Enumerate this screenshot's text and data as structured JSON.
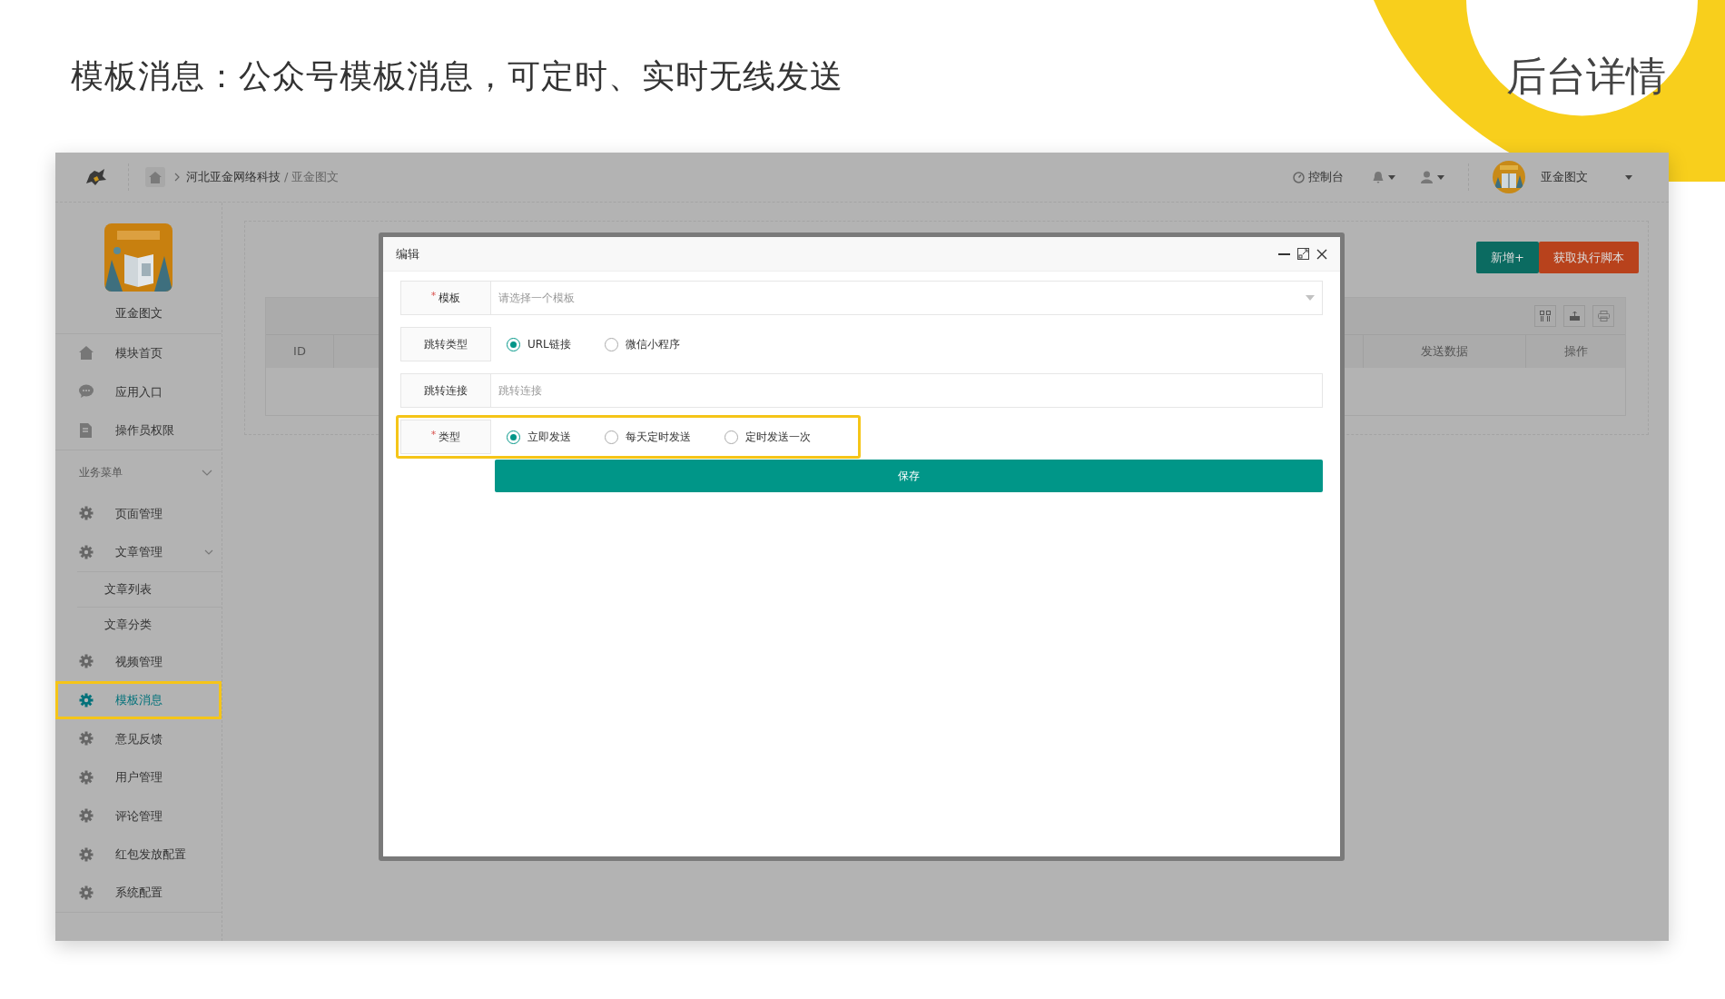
{
  "slide": {
    "title": "模板消息：公众号模板消息，可定时、实时无线发送",
    "tag": "后台详情"
  },
  "topbar": {
    "breadcrumb": [
      {
        "label": "河北亚金网络科技",
        "current": false
      },
      {
        "label": "亚金图文",
        "current": true
      }
    ],
    "separator": "/",
    "console": "控制台",
    "user_name": "亚金图文"
  },
  "sidebar": {
    "app_name": "亚金图文",
    "items": [
      {
        "label": "模块首页",
        "selected": false,
        "highlighted": false
      },
      {
        "label": "应用入口",
        "selected": false,
        "highlighted": false
      },
      {
        "label": "操作员权限",
        "selected": false,
        "highlighted": false
      }
    ],
    "section": {
      "label": "业务菜单",
      "expanded": true,
      "items": [
        {
          "label": "页面管理",
          "selected": false,
          "highlighted": false
        },
        {
          "label": "文章管理",
          "selected": false,
          "highlighted": false,
          "expanded": true,
          "children": [
            {
              "label": "文章列表",
              "selected": false
            },
            {
              "label": "文章分类",
              "selected": false
            }
          ]
        },
        {
          "label": "视频管理",
          "selected": false,
          "highlighted": false
        },
        {
          "label": "模板消息",
          "selected": true,
          "highlighted": true
        },
        {
          "label": "意见反馈",
          "selected": false,
          "highlighted": false
        },
        {
          "label": "用户管理",
          "selected": false,
          "highlighted": false
        },
        {
          "label": "评论管理",
          "selected": false,
          "highlighted": false
        },
        {
          "label": "红包发放配置",
          "selected": false,
          "highlighted": false
        },
        {
          "label": "系统配置",
          "selected": false,
          "highlighted": false
        }
      ]
    }
  },
  "actions": [
    {
      "label": "新增+",
      "kind": "primary"
    },
    {
      "label": "获取执行脚本",
      "kind": "danger"
    }
  ],
  "table": {
    "columns": [
      "ID",
      "发送数据",
      "操作"
    ]
  },
  "modal": {
    "title": "编辑",
    "fields": [
      {
        "kind": "select",
        "label": "模板",
        "required": true,
        "placeholder": "请选择一个模板",
        "highlighted": false
      },
      {
        "kind": "radio",
        "label": "跳转类型",
        "required": false,
        "highlighted": false,
        "options": [
          {
            "label": "URL链接",
            "selected": true
          },
          {
            "label": "微信小程序",
            "selected": false
          }
        ]
      },
      {
        "kind": "text",
        "label": "跳转连接",
        "required": false,
        "placeholder": "跳转连接",
        "highlighted": false
      },
      {
        "kind": "radio",
        "label": "类型",
        "required": true,
        "highlighted": true,
        "options": [
          {
            "label": "立即发送",
            "selected": true
          },
          {
            "label": "每天定时发送",
            "selected": false
          },
          {
            "label": "定时发送一次",
            "selected": false
          }
        ]
      }
    ],
    "required_mark": "*",
    "submit": "保存"
  }
}
